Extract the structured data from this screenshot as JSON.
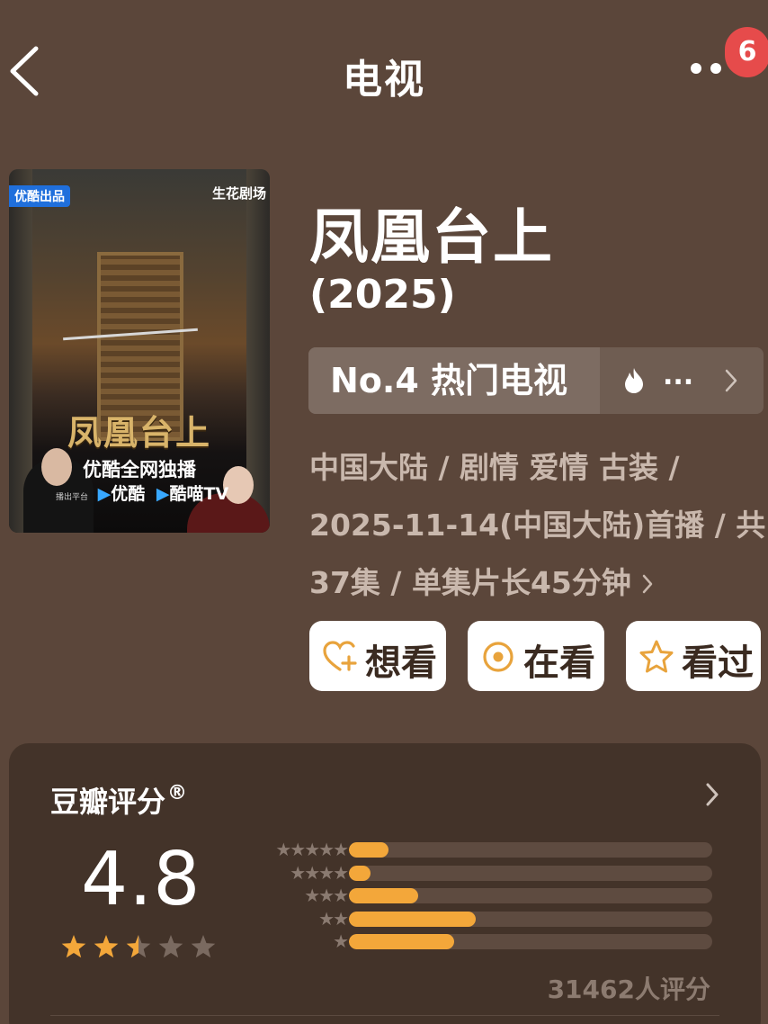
{
  "header": {
    "title": "电视",
    "notification_count": "6",
    "back_icon": "chevron-left-icon",
    "more_icon": "more-dots-icon"
  },
  "poster": {
    "top_left_tag": "优酷出品",
    "top_right_tag": "生花剧场",
    "title_art": "凤凰台上",
    "exclusive_text": "优酷全网独播",
    "platform_label": "播出平台",
    "platform_1": "优酷",
    "platform_2": "酷喵TV"
  },
  "show": {
    "title": "凤凰台上",
    "year": "(2025)",
    "rank_label": "No.4 热门电视",
    "rank_more": "...",
    "meta_line1": "中国大陆 / 剧情 爱情 古装 /",
    "meta_line2": "2025-11-14(中国大陆)首播 / 共",
    "meta_line3": "37集 / 单集片长45分钟"
  },
  "actions": [
    {
      "label": "想看",
      "icon": "heart-plus-icon"
    },
    {
      "label": "在看",
      "icon": "target-circle-icon"
    },
    {
      "label": "看过",
      "icon": "star-outline-icon"
    }
  ],
  "rating": {
    "title": "豆瓣评分",
    "reg_mark": "®",
    "score": "4.8",
    "score_stars": 2.5,
    "count_text": "31462人评分",
    "distribution": [
      {
        "stars": 5,
        "fraction": 0.11
      },
      {
        "stars": 4,
        "fraction": 0.06
      },
      {
        "stars": 3,
        "fraction": 0.19
      },
      {
        "stars": 2,
        "fraction": 0.35
      },
      {
        "stars": 1,
        "fraction": 0.29
      }
    ]
  },
  "colors": {
    "background": "#5b463a",
    "card": "#433329",
    "accent_star": "#f3a73a",
    "badge": "#e64b4b",
    "action_icon": "#e8a33c"
  }
}
